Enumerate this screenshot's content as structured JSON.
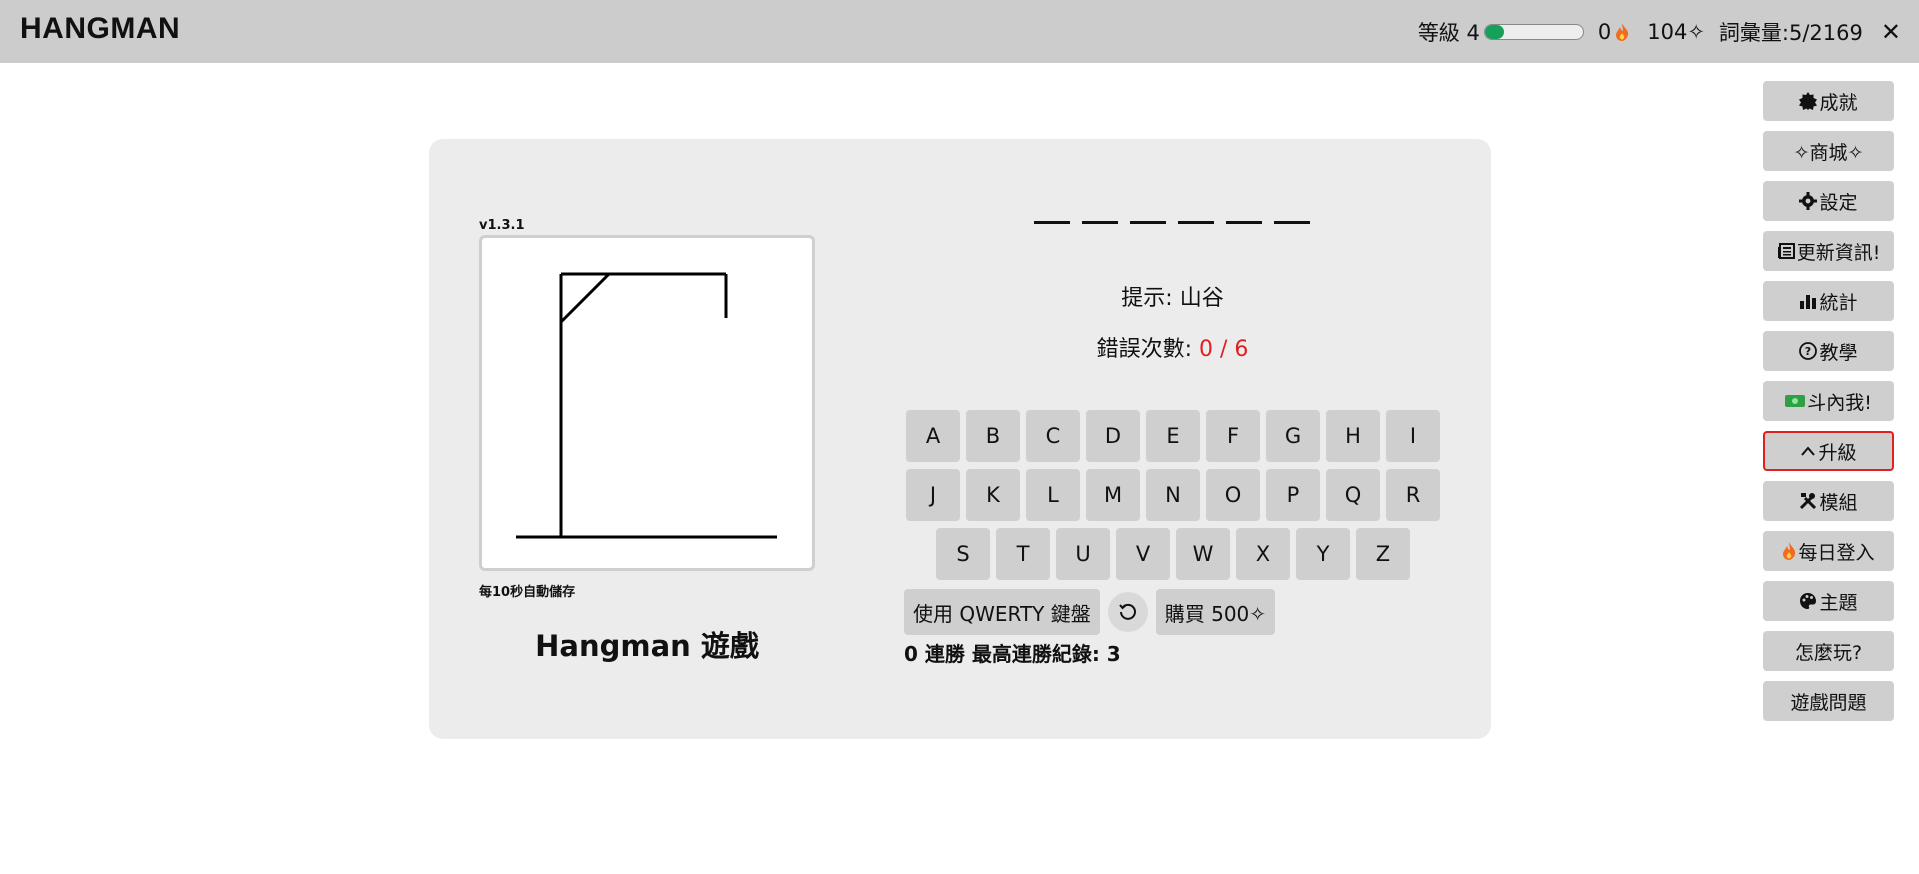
{
  "header": {
    "title": "HANGMAN",
    "level_label": "等級 4",
    "xp_progress": 0.2,
    "streak_count": "0",
    "gems": "104✧",
    "vocab": "詞彙量:5/2169",
    "close_glyph": "✕"
  },
  "game": {
    "version": "v1.3.1",
    "autosave_note": "每10秒自動儲存",
    "title": "Hangman 遊戲",
    "slots_count": 6,
    "hint": "提示: 山谷",
    "errors_label": "錯誤次數: ",
    "errors_value": "0 / 6"
  },
  "keyboard": {
    "row1": [
      "A",
      "B",
      "C",
      "D",
      "E",
      "F",
      "G",
      "H",
      "I"
    ],
    "row2": [
      "J",
      "K",
      "L",
      "M",
      "N",
      "O",
      "P",
      "Q",
      "R"
    ],
    "row3": [
      "S",
      "T",
      "U",
      "V",
      "W",
      "X",
      "Y",
      "Z"
    ],
    "qwerty_label": "使用 QWERTY 鍵盤",
    "buy_label": "購買 500✧",
    "streak_text": "0 連勝 最高連勝紀錄: 3"
  },
  "sidebar": {
    "items": [
      {
        "label": "成就",
        "icon": "badge-icon"
      },
      {
        "label": "✧商城✧",
        "icon": ""
      },
      {
        "label": "設定",
        "icon": "gear-icon"
      },
      {
        "label": "更新資訊!",
        "icon": "news-icon"
      },
      {
        "label": "統計",
        "icon": "bar-chart-icon"
      },
      {
        "label": "教學",
        "icon": "help-icon"
      },
      {
        "label": " 斗內我!",
        "icon": "money-icon"
      },
      {
        "label": "升級",
        "icon": "chevron-up-icon"
      },
      {
        "label": "模組",
        "icon": "tools-icon"
      },
      {
        "label": " 每日登入",
        "icon": "flame-icon"
      },
      {
        "label": "主題",
        "icon": "palette-icon"
      },
      {
        "label": "怎麼玩?",
        "icon": ""
      },
      {
        "label": "遊戲問題",
        "icon": ""
      }
    ]
  },
  "colors": {
    "xp_fill": "#17a05a",
    "error": "#e02020",
    "flame": "#f26a21"
  }
}
